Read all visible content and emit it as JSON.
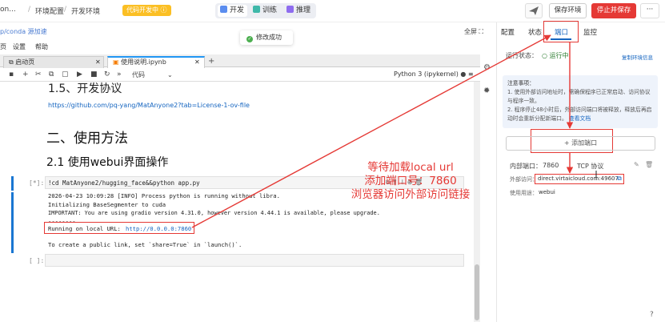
{
  "topbar": {
    "crumbs": [
      "on...",
      "环境配置",
      "开发环境"
    ],
    "crumb_sep": "/",
    "dev_badge": "代码开发中",
    "dev_badge_icon": "ⓘ",
    "modes": [
      "开发",
      "训练",
      "推理"
    ],
    "save_label": "保存环境",
    "stop_label": "停止并保存",
    "more_label": "···"
  },
  "subbar": {
    "conda_link": "p/conda 源加速",
    "fullscreen": "全屏"
  },
  "toast": {
    "text": "修改成功"
  },
  "jupyter": {
    "menu": [
      "页",
      "设置",
      "帮助"
    ],
    "tabs": [
      "启动页",
      "使用说明.ipynb"
    ],
    "tab_plus": "+",
    "cell_type": "代码",
    "kernel": "Python 3 (ipykernel)"
  },
  "notebook": {
    "h_license": "1.5、开发协议",
    "license_link": "https://github.com/pq-yang/MatAnyone2?tab=License-1-ov-file",
    "h_usage": "二、使用方法",
    "h_webui": "2.1 使用webui界面操作",
    "cell1_prompt": "[*]:",
    "cell1_code": "!cd MatAnyone2/hugging_face&&python app.py",
    "out_line1": "2026-04-23 10:09:28 [INFO] Process python is running without libra.",
    "out_line2": "Initializing BaseSegmenter to cuda",
    "out_line3": "IMPORTANT: You are using gradio version 4.31.0, however version 4.44.1 is available, please upgrade.",
    "out_line4": "--------",
    "out_local_label": "Running on local URL:",
    "out_local_url": "http://0.0.0.0:7860",
    "out_line6": "To create a public link, set `share=True` in `launch()`.",
    "cell2_prompt": "[ ]:"
  },
  "annotation": {
    "line1": "等待加载local url",
    "line2": "添加端口号：7860",
    "line3": "浏览器访问外部访问链接"
  },
  "right_panel": {
    "tabs": [
      "配置",
      "状态",
      "端口",
      "监控"
    ],
    "active_tab": "端口",
    "run_status_label": "运行状态：",
    "run_status_value": "运行中",
    "copy_env_info": "复制环境信息",
    "notice_title": "注意事项：",
    "notice_1": "1. 使用外部访问地址时，需确保程序已正常启动、访问协议与程序一致。",
    "notice_2": "2. 程序停止48小时后，外部访问端口将被释放，释放后再启动时会重新分配新端口。",
    "notice_doc_link": "查看文档",
    "add_port": "+ 添加端口",
    "internal_port_label": "内部端口：",
    "internal_port_value": "7860",
    "protocol": "TCP 协议",
    "external_label": "外部访问：",
    "external_url": "direct.virtaicloud.com:49607",
    "purpose_label": "使用用途：",
    "purpose_value": "webui"
  },
  "colors": {
    "accent": "#1565c0",
    "danger": "#e53935",
    "badge": "#fbbf24",
    "success": "#4caf50"
  }
}
